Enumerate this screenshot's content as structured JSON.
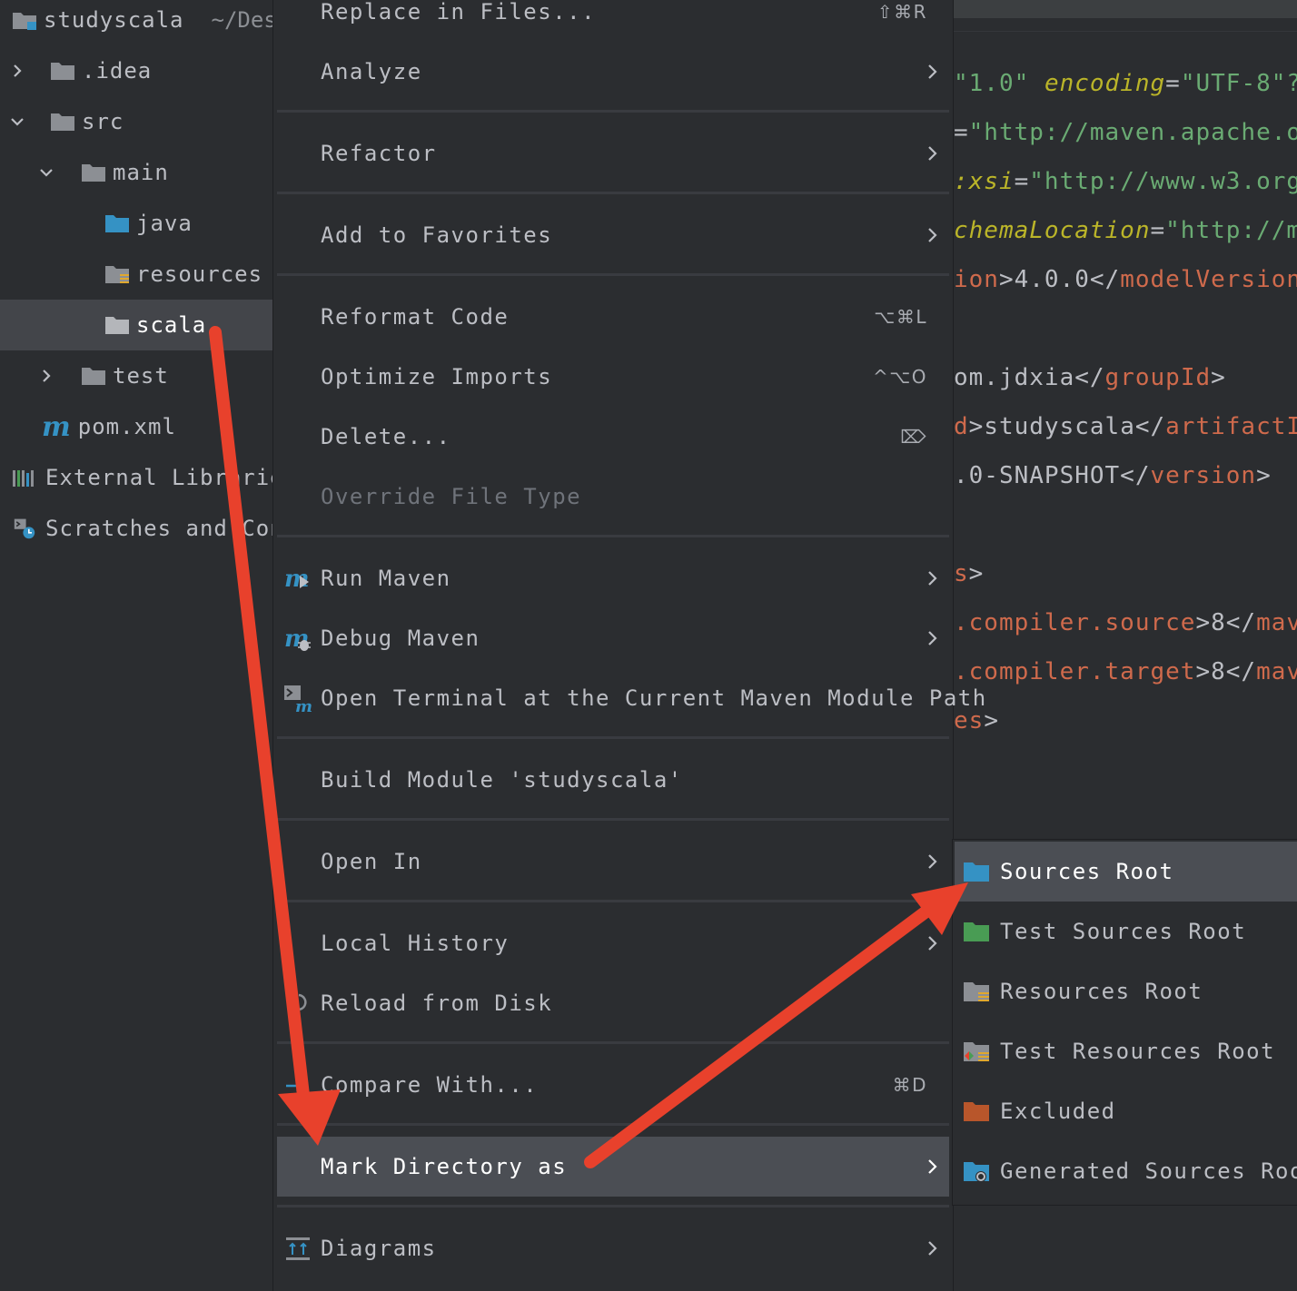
{
  "project_tree": {
    "root": {
      "name": "studyscala",
      "path": "~/Desk"
    },
    "items": [
      {
        "label": ".idea"
      },
      {
        "label": "src"
      },
      {
        "label": "main"
      },
      {
        "label": "java"
      },
      {
        "label": "resources"
      },
      {
        "label": "scala"
      },
      {
        "label": "test"
      },
      {
        "label": "pom.xml"
      },
      {
        "label": "External Libraries"
      },
      {
        "label": "Scratches and Consoles"
      }
    ]
  },
  "editor": {
    "lines": [
      {
        "s1": "\"1.0\"",
        "a1": "encoding",
        "p1": "=",
        "s2": "\"UTF-8\"?"
      },
      {
        "p1": "=",
        "s1": "\"http://maven.apache.o"
      },
      {
        "a1": ":xsi",
        "p1": "=",
        "s1": "\"http://www.w3.org"
      },
      {
        "a1": "chemaLocation",
        "p1": "=",
        "s1": "\"http://m"
      },
      {
        "t1": "ion",
        "p1": ">4.0.0</",
        "t2": "modelVersion"
      },
      {
        "p1": "om.jdxia</",
        "t1": "groupId",
        "p2": ">"
      },
      {
        "t1": "d",
        "p1": ">studyscala</",
        "t2": "artifactI"
      },
      {
        "p1": ".0-SNAPSHOT</",
        "t1": "version",
        "p2": ">"
      },
      {
        "t1": "s",
        "p1": ">"
      },
      {
        "t1": ".compiler.source",
        "p1": ">8</",
        "t2": "mav"
      },
      {
        "t1": ".compiler.target",
        "p1": ">8</",
        "t2": "mav"
      },
      {
        "t1": "es",
        "p1": ">"
      }
    ]
  },
  "context_menu": {
    "items": {
      "replace_in_files": {
        "label": "Replace in Files...",
        "shortcut": "⇧⌘R"
      },
      "analyze": {
        "label": "Analyze"
      },
      "refactor": {
        "label": "Refactor"
      },
      "add_to_favorites": {
        "label": "Add to Favorites"
      },
      "reformat_code": {
        "label": "Reformat Code",
        "shortcut": "⌥⌘L"
      },
      "optimize_imports": {
        "label": "Optimize Imports",
        "shortcut": "^⌥O"
      },
      "delete": {
        "label": "Delete...",
        "shortcut": "⌦"
      },
      "override_file_type": {
        "label": "Override File Type"
      },
      "run_maven": {
        "label": "Run Maven"
      },
      "debug_maven": {
        "label": "Debug Maven"
      },
      "open_terminal": {
        "label": "Open Terminal at the Current Maven Module Path"
      },
      "build_module": {
        "label": "Build Module 'studyscala'"
      },
      "open_in": {
        "label": "Open In"
      },
      "local_history": {
        "label": "Local History"
      },
      "reload_from_disk": {
        "label": "Reload from Disk"
      },
      "compare_with": {
        "label": "Compare With...",
        "shortcut": "⌘D"
      },
      "mark_directory_as": {
        "label": "Mark Directory as"
      },
      "diagrams": {
        "label": "Diagrams"
      }
    }
  },
  "mark_directory_submenu": {
    "items": [
      {
        "label": "Sources Root",
        "icon": "sources-root-folder-icon",
        "color": "#3592c4"
      },
      {
        "label": "Test Sources Root",
        "icon": "test-sources-root-folder-icon",
        "color": "#499c54"
      },
      {
        "label": "Resources Root",
        "icon": "resources-root-folder-icon",
        "color": "#8c8f94"
      },
      {
        "label": "Test Resources Root",
        "icon": "test-resources-root-folder-icon",
        "color": "#8c8f94"
      },
      {
        "label": "Excluded",
        "icon": "excluded-folder-icon",
        "color": "#b8562b"
      },
      {
        "label": "Generated Sources Root",
        "icon": "generated-sources-root-folder-icon",
        "color": "#3592c4"
      }
    ]
  },
  "colors": {
    "background": "#2b2d30",
    "highlight": "#4b4e54",
    "accent_blue": "#3592c4",
    "annotation_arrow": "#e8412c"
  }
}
